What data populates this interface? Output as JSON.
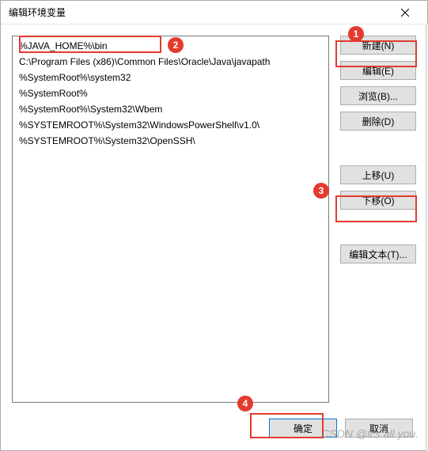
{
  "window": {
    "title": "编辑环境变量"
  },
  "list": {
    "items": [
      "%JAVA_HOME%\\bin",
      "C:\\Program Files (x86)\\Common Files\\Oracle\\Java\\javapath",
      "%SystemRoot%\\system32",
      "%SystemRoot%",
      "%SystemRoot%\\System32\\Wbem",
      "%SYSTEMROOT%\\System32\\WindowsPowerShell\\v1.0\\",
      "%SYSTEMROOT%\\System32\\OpenSSH\\"
    ],
    "selected_index": 0
  },
  "buttons": {
    "new": "新建(N)",
    "edit": "编辑(E)",
    "browse": "浏览(B)...",
    "delete": "删除(D)",
    "move_up": "上移(U)",
    "move_down": "下移(O)",
    "edit_text": "编辑文本(T)...",
    "ok": "确定",
    "cancel": "取消"
  },
  "annotations": {
    "c1": "1",
    "c2": "2",
    "c3": "3",
    "c4": "4"
  },
  "watermark": "CSDN @it's all you."
}
